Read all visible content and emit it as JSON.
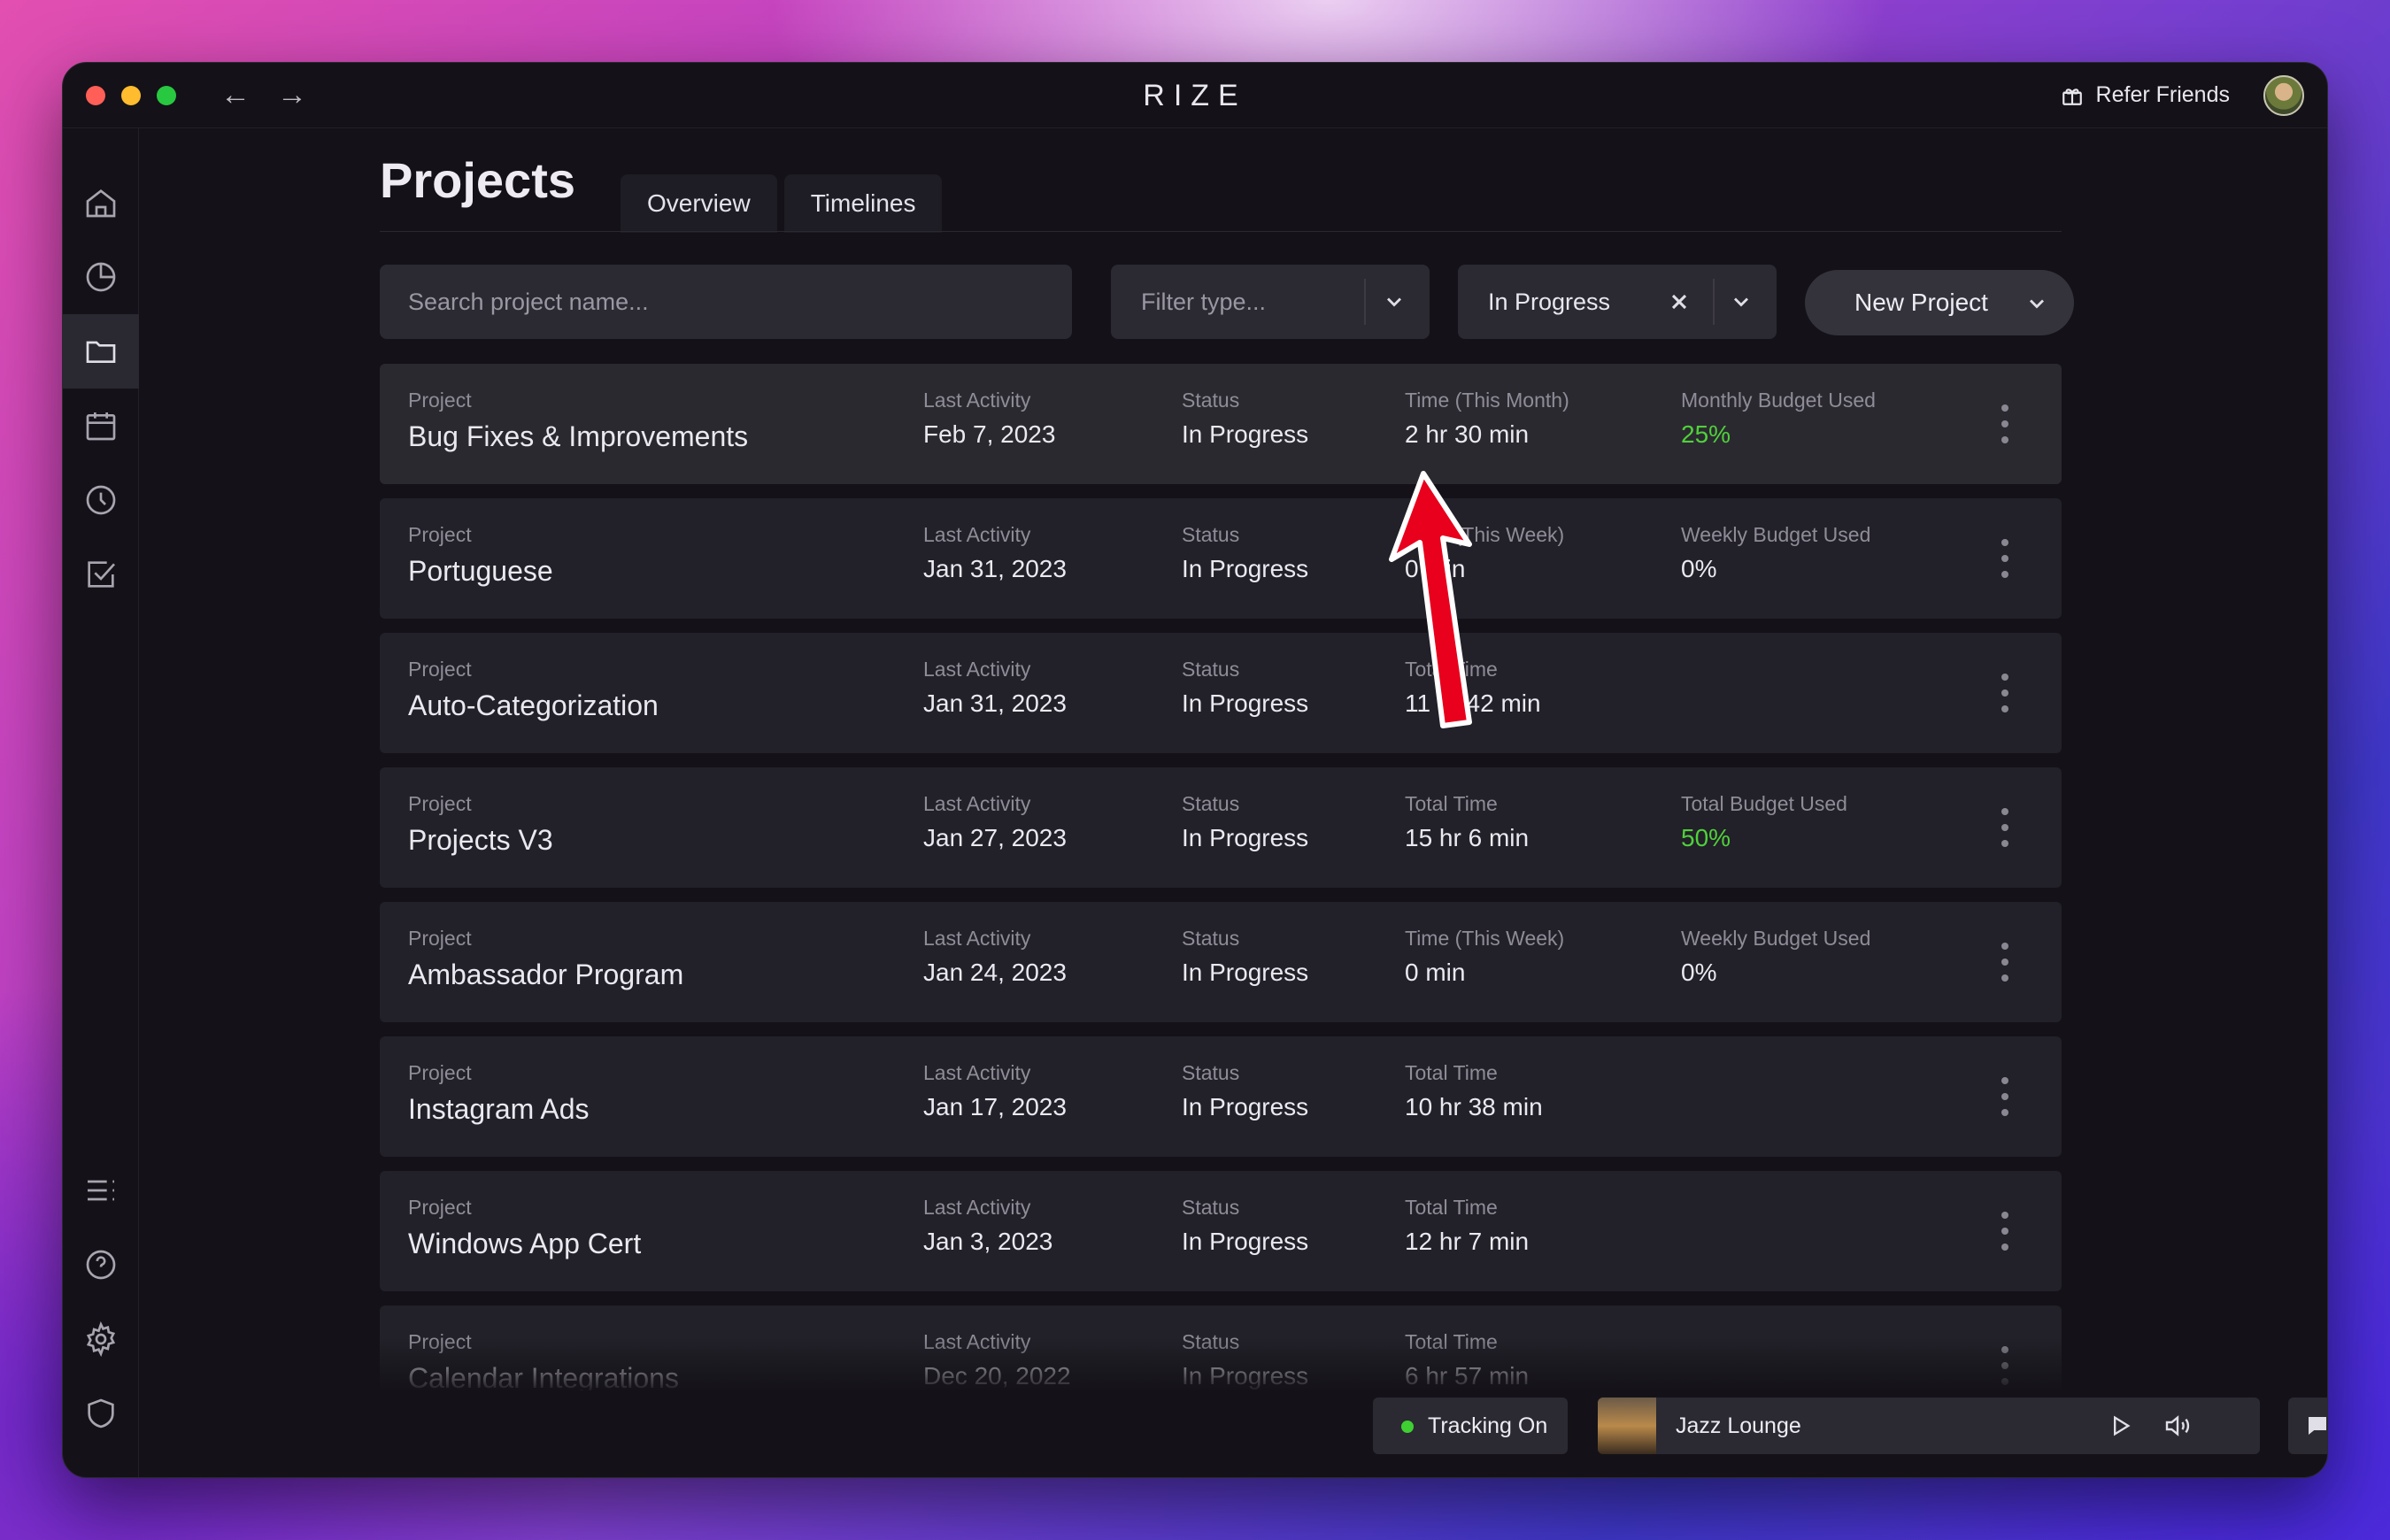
{
  "app": {
    "title": "RIZE",
    "refer_label": "Refer Friends"
  },
  "page": {
    "title": "Projects",
    "tabs": [
      {
        "label": "Overview"
      },
      {
        "label": "Timelines"
      }
    ]
  },
  "toolbar": {
    "search_placeholder": "Search project name...",
    "filter_placeholder": "Filter type...",
    "status_value": "In Progress",
    "new_project_label": "New Project"
  },
  "projects": [
    {
      "label_project": "Project",
      "name": "Bug Fixes & Improvements",
      "label_activity": "Last Activity",
      "activity": "Feb 7, 2023",
      "label_status": "Status",
      "status": "In Progress",
      "label_time": "Time (This Month)",
      "time": "2 hr 30 min",
      "label_budget": "Monthly Budget Used",
      "budget": "25%",
      "budget_color": "#4fd13b"
    },
    {
      "label_project": "Project",
      "name": "Portuguese",
      "label_activity": "Last Activity",
      "activity": "Jan 31, 2023",
      "label_status": "Status",
      "status": "In Progress",
      "label_time": "Time (This Week)",
      "time": "0 min",
      "label_budget": "Weekly Budget Used",
      "budget": "0%",
      "budget_color": "#ebe9f0"
    },
    {
      "label_project": "Project",
      "name": "Auto-Categorization",
      "label_activity": "Last Activity",
      "activity": "Jan 31, 2023",
      "label_status": "Status",
      "status": "In Progress",
      "label_time": "Total Time",
      "time": "11 hr 42 min",
      "label_budget": "",
      "budget": ""
    },
    {
      "label_project": "Project",
      "name": "Projects V3",
      "label_activity": "Last Activity",
      "activity": "Jan 27, 2023",
      "label_status": "Status",
      "status": "In Progress",
      "label_time": "Total Time",
      "time": "15 hr 6 min",
      "label_budget": "Total Budget Used",
      "budget": "50%",
      "budget_color": "#4fd13b"
    },
    {
      "label_project": "Project",
      "name": "Ambassador Program",
      "label_activity": "Last Activity",
      "activity": "Jan 24, 2023",
      "label_status": "Status",
      "status": "In Progress",
      "label_time": "Time (This Week)",
      "time": "0 min",
      "label_budget": "Weekly Budget Used",
      "budget": "0%",
      "budget_color": "#ebe9f0"
    },
    {
      "label_project": "Project",
      "name": "Instagram Ads",
      "label_activity": "Last Activity",
      "activity": "Jan 17, 2023",
      "label_status": "Status",
      "status": "In Progress",
      "label_time": "Total Time",
      "time": "10 hr 38 min",
      "label_budget": "",
      "budget": ""
    },
    {
      "label_project": "Project",
      "name": "Windows App Cert",
      "label_activity": "Last Activity",
      "activity": "Jan 3, 2023",
      "label_status": "Status",
      "status": "In Progress",
      "label_time": "Total Time",
      "time": "12 hr 7 min",
      "label_budget": "",
      "budget": ""
    },
    {
      "label_project": "Project",
      "name": "Calendar Integrations",
      "label_activity": "Last Activity",
      "activity": "Dec 20, 2022",
      "label_status": "Status",
      "status": "In Progress",
      "label_time": "Total Time",
      "time": "6 hr 57 min",
      "label_budget": "",
      "budget": ""
    }
  ],
  "footer": {
    "tracking_label": "Tracking On",
    "tracking_color": "#3fcf32",
    "player_track": "Jazz Lounge"
  },
  "sidebar": {
    "top_icons": [
      "home-icon",
      "chart-pie-icon",
      "folder-icon",
      "calendar-icon",
      "clock-icon",
      "checkbox-icon"
    ],
    "bottom_icons": [
      "list-icon",
      "help-icon",
      "gear-icon",
      "shield-icon"
    ],
    "active": "folder-icon"
  },
  "annotation": {
    "arrow_color": "#e8001c"
  }
}
